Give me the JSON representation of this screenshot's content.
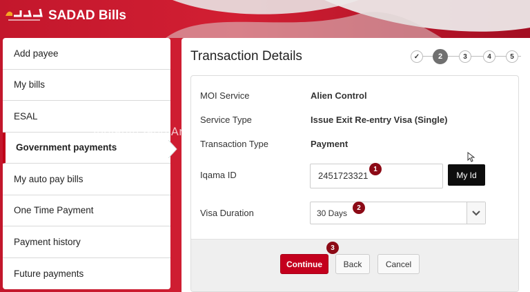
{
  "header": {
    "app_title": "SADAD Bills",
    "logo_text": "سداد"
  },
  "sidebar": {
    "items": [
      {
        "label": "Add payee"
      },
      {
        "label": "My bills"
      },
      {
        "label": "ESAL"
      },
      {
        "label": "Government payments",
        "active": true
      },
      {
        "label": "My auto pay bills"
      },
      {
        "label": "One Time Payment"
      },
      {
        "label": "Payment history"
      },
      {
        "label": "Future payments"
      }
    ]
  },
  "watermark": "IndianInSaudiArabia.com",
  "main": {
    "title": "Transaction Details",
    "steps": [
      "✓",
      "2",
      "3",
      "4",
      "5"
    ],
    "current_step": 2,
    "fields": {
      "moi_service": {
        "label": "MOI Service",
        "value": "Alien Control"
      },
      "service_type": {
        "label": "Service Type",
        "value": "Issue Exit Re-entry Visa (Single)"
      },
      "transaction_type": {
        "label": "Transaction Type",
        "value": "Payment"
      },
      "iqama_id": {
        "label": "Iqama ID",
        "value": "2451723321"
      },
      "visa_duration": {
        "label": "Visa Duration",
        "value": "30 Days"
      }
    },
    "my_id_label": "My Id",
    "buttons": {
      "continue": "Continue",
      "back": "Back",
      "cancel": "Cancel"
    },
    "annotations": [
      "1",
      "2",
      "3"
    ]
  },
  "colors": {
    "brand_red": "#c4001d",
    "badge_red": "#8c0a16",
    "step_current": "#707070"
  }
}
